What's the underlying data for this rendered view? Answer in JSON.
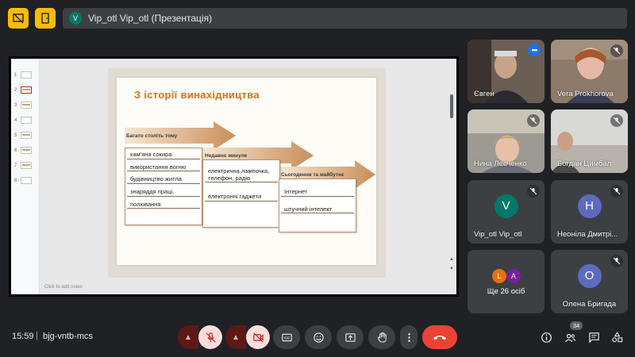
{
  "topbar": {
    "title": "Vip_otl Vip_otl (Презентація)",
    "avatar_letter": "V"
  },
  "presentation": {
    "thumbnail_numbers": [
      "1",
      "2",
      "3",
      "4",
      "5",
      "6",
      "7",
      "8"
    ],
    "notes_placeholder": "Click to add notes",
    "slide": {
      "title": "З історії винахідництва",
      "columns": [
        {
          "heading": "Багато століть тому",
          "items": [
            "кам'яна сокира",
            "використання вогню",
            "будівництво житла",
            "знаряддя праці,",
            "полювання"
          ]
        },
        {
          "heading": "Недавнє минуле",
          "items": [
            "електрична лампочка, телефон, радіо",
            "електронні гаджети"
          ]
        },
        {
          "heading": "Сьогодення та майбутнє",
          "items": [
            "Інтернет",
            "штучний інтелект"
          ]
        }
      ]
    }
  },
  "participants": [
    {
      "name": "Євген",
      "type": "video"
    },
    {
      "name": "Vera Prokhorova",
      "type": "video"
    },
    {
      "name": "Нина Левченко",
      "type": "video"
    },
    {
      "name": "Богдан Цимбал",
      "type": "video"
    },
    {
      "name": "Vip_otl Vip_otl",
      "letter": "V",
      "color": "#00796b"
    },
    {
      "name": "Неоніла Дмитрі...",
      "letter": "H",
      "color": "#5c6bc0"
    },
    {
      "name": "Ще 26 осіб",
      "letters": [
        "L",
        "A"
      ],
      "colors": [
        "#e8710a",
        "#7b1fa2"
      ]
    },
    {
      "name": "Олена Бригада",
      "letter": "O",
      "color": "#5c6bc0"
    }
  ],
  "bottombar": {
    "time": "15:59",
    "separator": "|",
    "meeting_code": "bjg-vntb-mcs",
    "people_count": "34"
  },
  "colors": {
    "accent_yellow": "#fbbc04",
    "end_call": "#ea4335",
    "slide_title": "#d86f1b"
  }
}
